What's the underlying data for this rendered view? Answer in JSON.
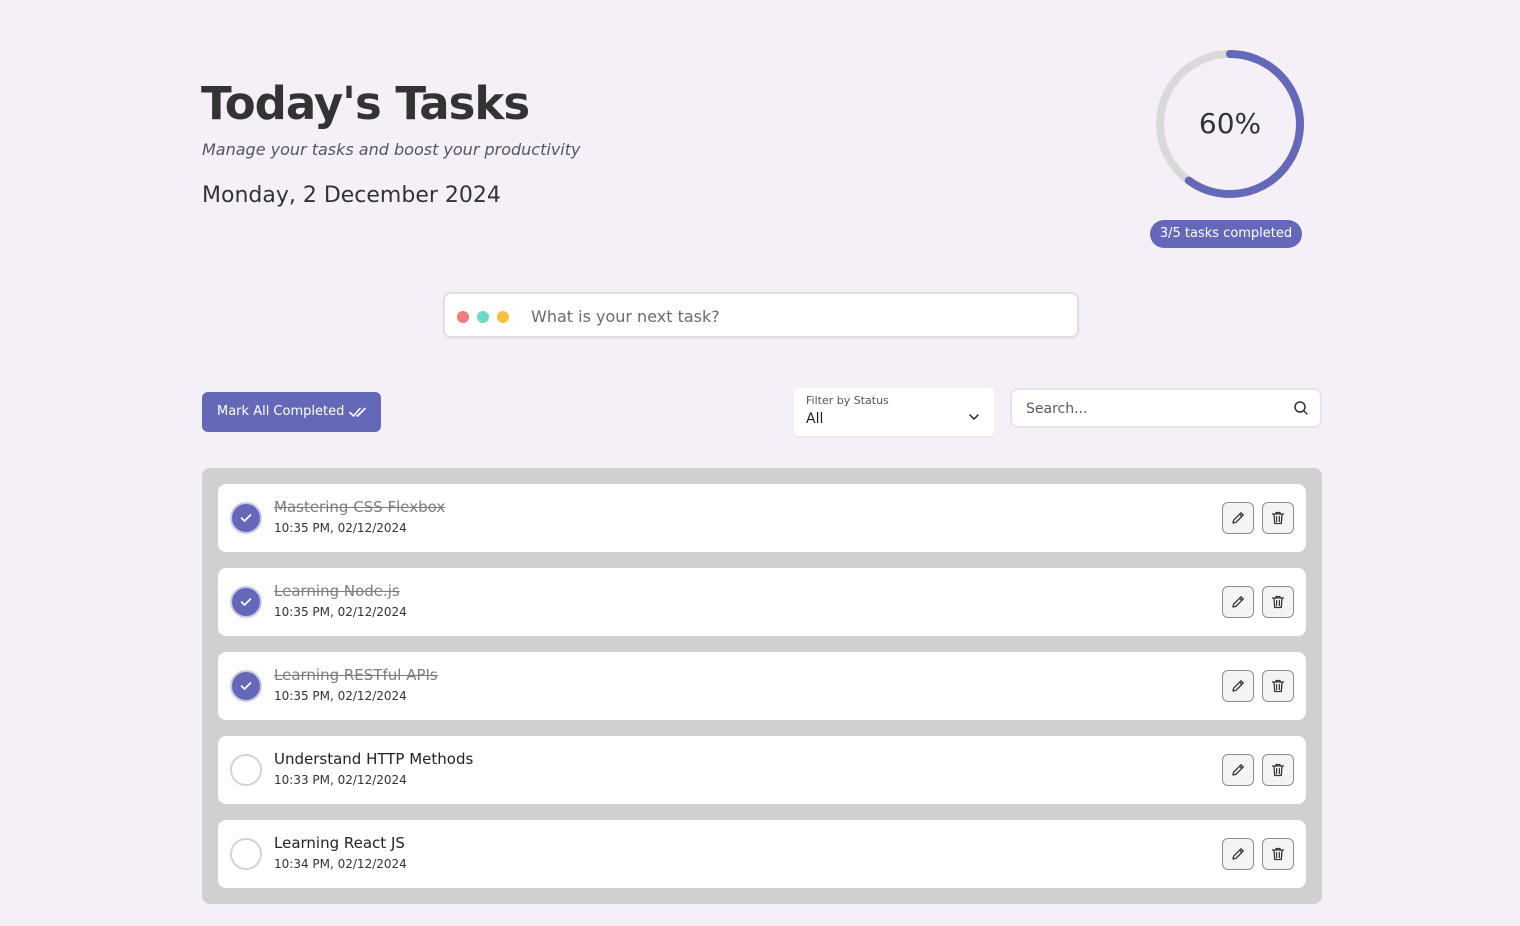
{
  "header": {
    "title": "Today's Tasks",
    "subtitle": "Manage your tasks and boost your productivity",
    "date": "Monday, 2 December 2024"
  },
  "progress": {
    "percent_label": "60%",
    "fraction": 0.6,
    "summary": "3/5 tasks completed",
    "accent_color": "#6468b8",
    "track_color": "#d9d9d9"
  },
  "new_task": {
    "placeholder": "What is your next task?",
    "dot_colors": [
      "#f47c7c",
      "#70d6c5",
      "#f6c23e"
    ]
  },
  "toolbar": {
    "mark_all_label": "Mark All Completed",
    "mark_all_icon": "double-check-icon",
    "filter_label": "Filter by Status",
    "filter_value": "All",
    "search_placeholder": "Search...",
    "search_icon": "search-icon"
  },
  "tasks": [
    {
      "title": "Mastering CSS Flexbox",
      "time": "10:35 PM, 02/12/2024",
      "completed": true
    },
    {
      "title": "Learning Node.js",
      "time": "10:35 PM, 02/12/2024",
      "completed": true
    },
    {
      "title": "Learning RESTful APIs",
      "time": "10:35 PM, 02/12/2024",
      "completed": true
    },
    {
      "title": "Understand HTTP Methods",
      "time": "10:33 PM, 02/12/2024",
      "completed": false
    },
    {
      "title": "Learning React JS",
      "time": "10:34 PM, 02/12/2024",
      "completed": false
    }
  ],
  "task_actions": {
    "edit_icon": "pencil-icon",
    "delete_icon": "trash-icon"
  }
}
